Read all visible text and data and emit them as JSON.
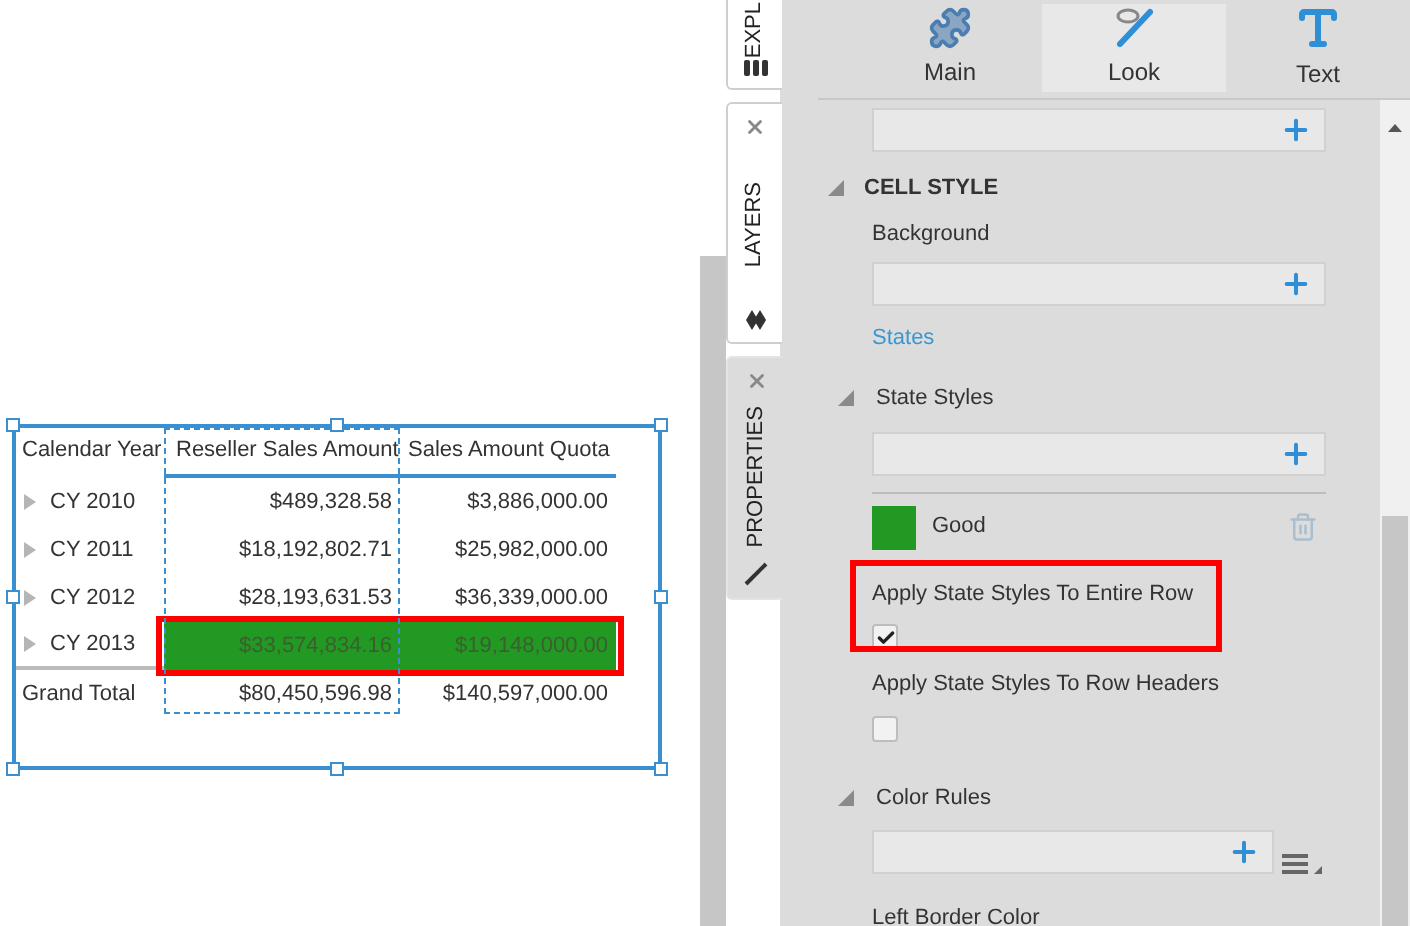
{
  "canvas": {
    "table": {
      "columns": [
        "Calendar Year",
        "Reseller Sales Amount",
        "Sales Amount Quota"
      ],
      "rows": [
        {
          "label": "CY 2010",
          "expanded": false,
          "values": [
            "$489,328.58",
            "$3,886,000.00"
          ],
          "highlighted": false,
          "annotated": false
        },
        {
          "label": "CY 2011",
          "expanded": false,
          "values": [
            "$18,192,802.71",
            "$25,982,000.00"
          ],
          "highlighted": false,
          "annotated": false
        },
        {
          "label": "CY 2012",
          "expanded": false,
          "values": [
            "$28,193,631.53",
            "$36,339,000.00"
          ],
          "highlighted": false,
          "annotated": false
        },
        {
          "label": "CY 2013",
          "expanded": false,
          "values": [
            "$33,574,834.16",
            "$19,148,000.00"
          ],
          "highlighted": true,
          "annotated": true
        }
      ],
      "total": {
        "label": "Grand Total",
        "values": [
          "$80,450,596.98",
          "$140,597,000.00"
        ]
      }
    }
  },
  "side_tabs": [
    {
      "kind": "explore",
      "label": "EXPL",
      "selected": false
    },
    {
      "kind": "layers",
      "label": "LAYERS",
      "selected": false
    },
    {
      "kind": "properties",
      "label": "PROPERTIES",
      "selected": true
    }
  ],
  "toolbar": [
    {
      "kind": "main",
      "label": "Main",
      "selected": false
    },
    {
      "kind": "look",
      "label": "Look",
      "selected": true
    },
    {
      "kind": "text",
      "label": "Text",
      "selected": false
    }
  ],
  "cell_style": {
    "heading": "CELL STYLE",
    "expanded": true,
    "background_label": "Background",
    "states_link": "States",
    "state_styles": {
      "label": "State Styles",
      "expanded": true,
      "items": [
        {
          "name": "Good",
          "color": "#229922"
        }
      ]
    },
    "checkboxes": [
      {
        "label": "Apply State Styles To Entire Row",
        "checked": true,
        "annotated": true
      },
      {
        "label": "Apply State Styles To Row Headers",
        "checked": false,
        "annotated": false
      }
    ],
    "color_rules": {
      "label": "Color Rules",
      "expanded": true
    },
    "left_border_label": "Left Border Color"
  }
}
